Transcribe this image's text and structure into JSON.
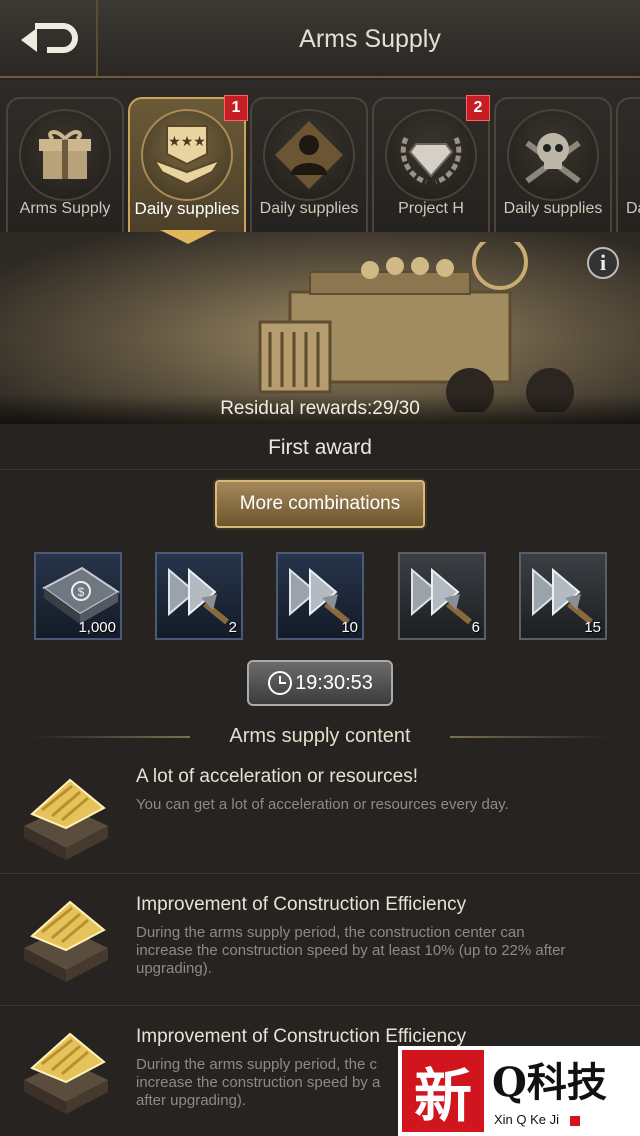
{
  "header": {
    "title": "Arms Supply"
  },
  "tabs": [
    {
      "label": "Arms Supply",
      "icon": "gift-box-icon",
      "badge": ""
    },
    {
      "label": "Daily supplies",
      "icon": "rank-insignia-icon",
      "badge": "1",
      "active": true
    },
    {
      "label": "Daily supplies",
      "icon": "soldier-bust-icon",
      "badge": ""
    },
    {
      "label": "Project H",
      "icon": "diamond-laurel-icon",
      "badge": "2"
    },
    {
      "label": "Daily supplies",
      "icon": "skull-crossbones-icon",
      "badge": ""
    },
    {
      "label": "Da",
      "icon": "",
      "badge": ""
    }
  ],
  "banner": {
    "residual_rewards": "Residual rewards:29/30",
    "info_label": "i"
  },
  "first_award": "First award",
  "more_combinations": "More combinations",
  "rewards": [
    {
      "item": "cash-stack-icon",
      "count": "1,000"
    },
    {
      "item": "speedup-arrows-icon",
      "count": "2"
    },
    {
      "item": "speedup-arrows-icon",
      "count": "10"
    },
    {
      "item": "speedup-arrows-icon",
      "count": "6"
    },
    {
      "item": "speedup-arrows-icon",
      "count": "15"
    }
  ],
  "timer": "19:30:53",
  "section_title": "Arms supply content",
  "content_items": [
    {
      "title": "A lot of acceleration or resources!",
      "desc": "You can get a lot of acceleration or resources every day."
    },
    {
      "title": "Improvement of Construction Efficiency",
      "desc": "During the arms supply period, the construction center can increase the construction speed by at least 10% (up to 22% after upgrading)."
    },
    {
      "title": "Improvement of Construction Efficiency",
      "desc": "During the arms supply period, the c"
    }
  ],
  "content_items_extra": {
    "desc3_line2": "increase the construction speed by a",
    "desc3_line3": "after upgrading)."
  },
  "watermark": {
    "char": "新",
    "brand": "Q科技",
    "sub": "Xin Q Ke Ji"
  }
}
